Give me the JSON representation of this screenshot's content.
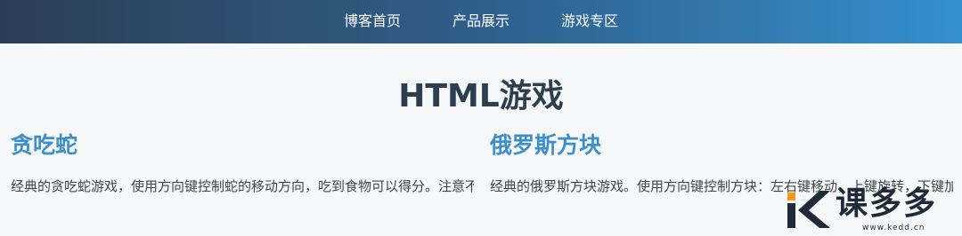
{
  "nav": {
    "items": [
      {
        "label": "博客首页"
      },
      {
        "label": "产品展示"
      },
      {
        "label": "游戏专区"
      }
    ]
  },
  "page": {
    "title": "HTML游戏"
  },
  "games": [
    {
      "title": "贪吃蛇",
      "description": "经典的贪吃蛇游戏，使用方向键控制蛇的移动方向，吃到食物可以得分。注意不"
    },
    {
      "title": "俄罗斯方块",
      "description": "经典的俄罗斯方块游戏。使用方向键控制方块：左右键移动，上键旋转，下键加"
    }
  ],
  "watermark": {
    "text": "课多多",
    "url": "www.kedd.cn",
    "colors": {
      "orange": "#f39a1e",
      "dark": "#1f2b38"
    }
  },
  "colors": {
    "nav_start": "#2c3e56",
    "nav_end": "#3590cf",
    "title": "#2c3e50",
    "card_title": "#3d8fcb"
  }
}
